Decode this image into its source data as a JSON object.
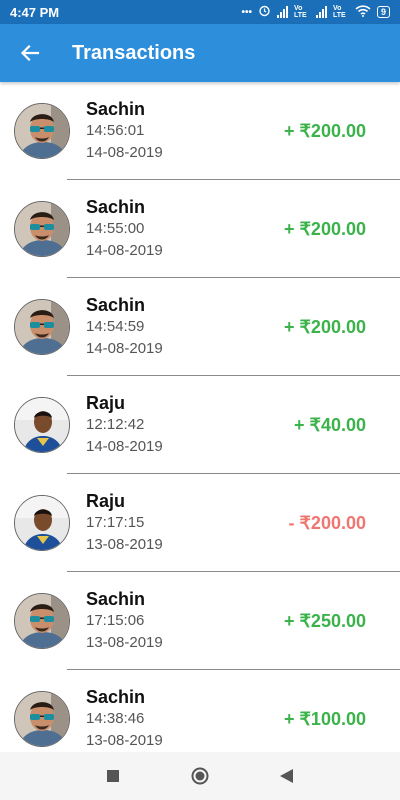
{
  "status": {
    "time": "4:47 PM",
    "battery": "9",
    "lte1": "Vo LTE",
    "lte2": "Vo LTE"
  },
  "header": {
    "title": "Transactions",
    "back_icon": "arrow-back-icon"
  },
  "colors": {
    "credit": "#3bb34a",
    "debit": "#f07672",
    "app_bar": "#2d8fdc",
    "status_bar": "#1a6fb8"
  },
  "transactions": [
    {
      "name": "Sachin",
      "time": "14:56:01",
      "date": "14-08-2019",
      "amount": "+ ₹200.00",
      "type": "credit",
      "avatar": "sachin"
    },
    {
      "name": "Sachin",
      "time": "14:55:00",
      "date": "14-08-2019",
      "amount": "+ ₹200.00",
      "type": "credit",
      "avatar": "sachin"
    },
    {
      "name": "Sachin",
      "time": "14:54:59",
      "date": "14-08-2019",
      "amount": "+ ₹200.00",
      "type": "credit",
      "avatar": "sachin"
    },
    {
      "name": "Raju",
      "time": "12:12:42",
      "date": "14-08-2019",
      "amount": "+ ₹40.00",
      "type": "credit",
      "avatar": "raju"
    },
    {
      "name": "Raju",
      "time": "17:17:15",
      "date": "13-08-2019",
      "amount": "- ₹200.00",
      "type": "debit",
      "avatar": "raju"
    },
    {
      "name": "Sachin",
      "time": "17:15:06",
      "date": "13-08-2019",
      "amount": "+ ₹250.00",
      "type": "credit",
      "avatar": "sachin"
    },
    {
      "name": "Sachin",
      "time": "14:38:46",
      "date": "13-08-2019",
      "amount": "+ ₹100.00",
      "type": "credit",
      "avatar": "sachin"
    }
  ],
  "nav": {
    "recents_icon": "square-recents-icon",
    "home_icon": "circle-home-icon",
    "back_icon": "triangle-back-icon"
  }
}
